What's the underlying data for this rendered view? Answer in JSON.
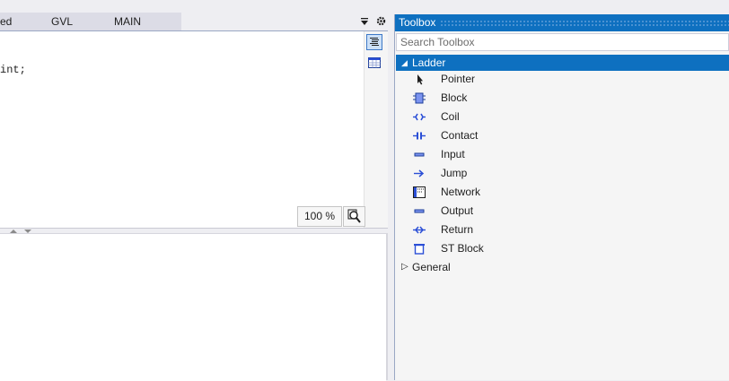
{
  "editor": {
    "tabs": [
      {
        "label": "ed"
      },
      {
        "label": "GVL"
      },
      {
        "label": "MAIN"
      }
    ],
    "code_fragment": "int;",
    "zoom_level": "100 %"
  },
  "toolbox": {
    "title": "Toolbox",
    "search_placeholder": "Search Toolbox",
    "categories": [
      {
        "name": "Ladder",
        "expanded": true,
        "items": [
          {
            "label": "Pointer",
            "icon": "pointer-icon"
          },
          {
            "label": "Block",
            "icon": "block-icon"
          },
          {
            "label": "Coil",
            "icon": "coil-icon"
          },
          {
            "label": "Contact",
            "icon": "contact-icon"
          },
          {
            "label": "Input",
            "icon": "input-icon"
          },
          {
            "label": "Jump",
            "icon": "jump-icon"
          },
          {
            "label": "Network",
            "icon": "network-icon"
          },
          {
            "label": "Output",
            "icon": "output-icon"
          },
          {
            "label": "Return",
            "icon": "return-icon"
          },
          {
            "label": "ST Block",
            "icon": "st-block-icon"
          }
        ]
      },
      {
        "name": "General",
        "expanded": false,
        "items": []
      }
    ]
  },
  "colors": {
    "accent": "#0e70c0",
    "icon_blue": "#2b4fd6"
  }
}
